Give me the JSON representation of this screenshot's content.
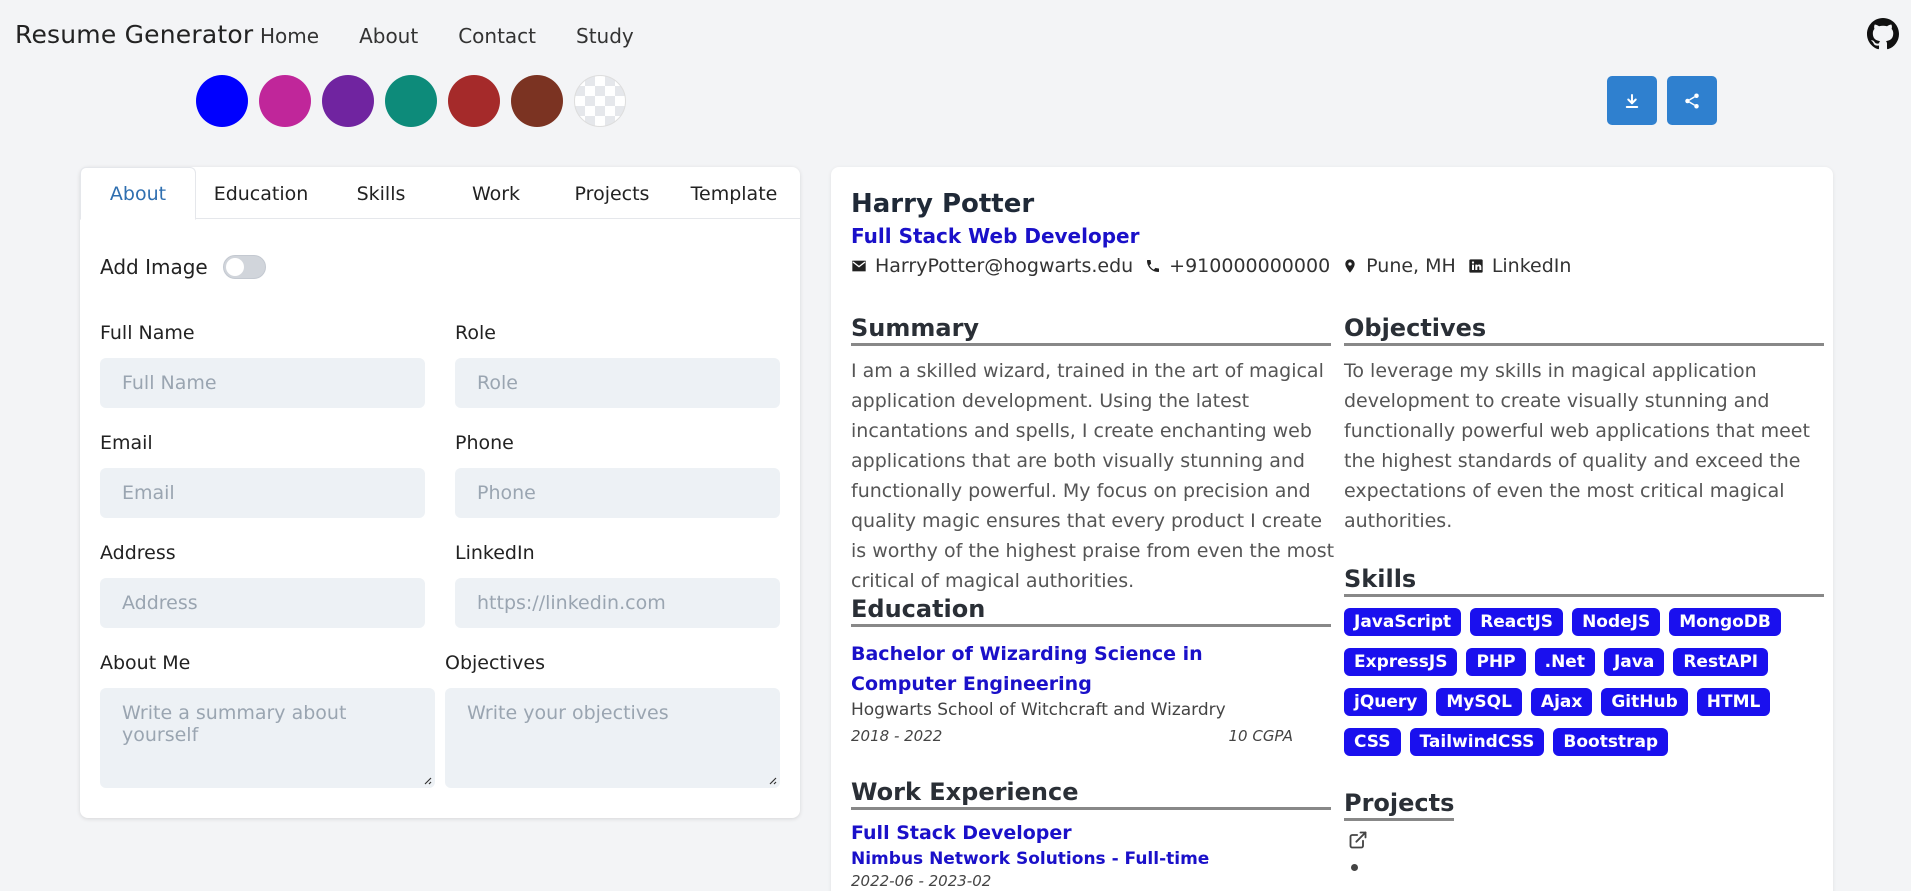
{
  "nav": {
    "brand": "Resume Generator",
    "links": [
      "Home",
      "About",
      "Contact",
      "Study"
    ],
    "github_icon": "github-icon"
  },
  "theme_colors": [
    "#0000ff",
    "#c0269a",
    "#7024a0",
    "#0d8b7a",
    "#a52a2a",
    "#7b3322",
    "transparent"
  ],
  "actions": {
    "download_icon": "download-icon",
    "share_icon": "share-icon"
  },
  "form": {
    "tabs": [
      "About",
      "Education",
      "Skills",
      "Work",
      "Projects",
      "Template"
    ],
    "active_tab": "About",
    "add_image_label": "Add Image",
    "add_image_enabled": false,
    "fields": {
      "full_name": {
        "label": "Full Name",
        "placeholder": "Full Name"
      },
      "role": {
        "label": "Role",
        "placeholder": "Role"
      },
      "email": {
        "label": "Email",
        "placeholder": "Email"
      },
      "phone": {
        "label": "Phone",
        "placeholder": "Phone"
      },
      "address": {
        "label": "Address",
        "placeholder": "Address"
      },
      "linkedin": {
        "label": "LinkedIn",
        "placeholder": "https://linkedin.com"
      },
      "about_me": {
        "label": "About Me",
        "placeholder": "Write a summary about yourself"
      },
      "objectives": {
        "label": "Objectives",
        "placeholder": "Write your objectives"
      }
    }
  },
  "resume": {
    "name": "Harry Potter",
    "role": "Full Stack Web Developer",
    "email": "HarryPotter@hogwarts.edu",
    "phone": "+910000000000",
    "location": "Pune, MH",
    "linkedin": "LinkedIn",
    "summary_title": "Summary",
    "summary": "I am a skilled wizard, trained in the art of magical application development. Using the latest incantations and spells, I create enchanting web applications that are both visually stunning and functionally powerful. My focus on precision and quality magic ensures that every product I create is worthy of the highest praise from even the most critical of magical authorities.",
    "objectives_title": "Objectives",
    "objectives": "To leverage my skills in magical application development to create visually stunning and functionally powerful web applications that meet the highest standards of quality and exceed the expectations of even the most critical magical authorities.",
    "education_title": "Education",
    "education": {
      "degree": "Bachelor of Wizarding Science in Computer Engineering",
      "school": "Hogwarts School of Witchcraft and Wizardry",
      "years": "2018 - 2022",
      "grade": "10 CGPA"
    },
    "skills_title": "Skills",
    "skills": [
      "JavaScript",
      "ReactJS",
      "NodeJS",
      "MongoDB",
      "ExpressJS",
      "PHP",
      ".Net",
      "Java",
      "RestAPI",
      "jQuery",
      "MySQL",
      "Ajax",
      "GitHub",
      "HTML",
      "CSS",
      "TailwindCSS",
      "Bootstrap"
    ],
    "work_title": "Work Experience",
    "work": {
      "title": "Full Stack Developer",
      "company": "Nimbus Network Solutions - Full-time",
      "dates": "2022-06 - 2023-02"
    },
    "projects_title": "Projects"
  }
}
